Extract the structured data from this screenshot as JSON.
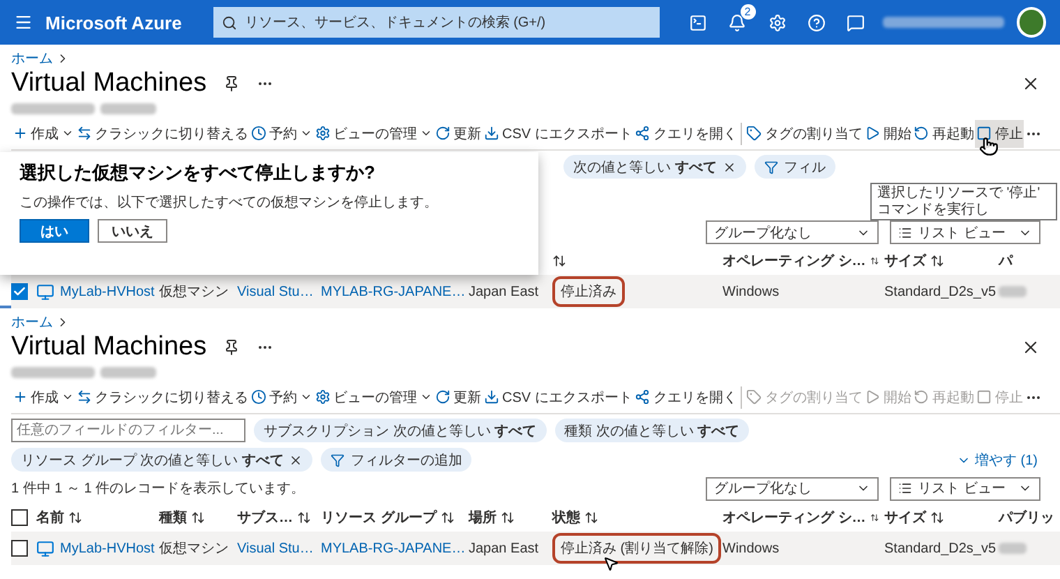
{
  "topbar": {
    "brand": "Microsoft Azure",
    "search_placeholder": "リソース、サービス、ドキュメントの検索 (G+/)",
    "notification_count": "2"
  },
  "panels": [
    {
      "breadcrumb": "ホーム",
      "title": "Virtual Machines",
      "toolbar": [
        {
          "kind": "create",
          "label": "作成",
          "caret": true,
          "disabled": false,
          "hovered": false
        },
        {
          "kind": "switch",
          "label": "クラシックに切り替える",
          "caret": false,
          "disabled": false,
          "hovered": false
        },
        {
          "kind": "schedule",
          "label": "予約",
          "caret": true,
          "disabled": false,
          "hovered": false
        },
        {
          "kind": "view",
          "label": "ビューの管理",
          "caret": true,
          "disabled": false,
          "hovered": false
        },
        {
          "kind": "refresh",
          "label": "更新",
          "caret": false,
          "disabled": false,
          "hovered": false
        },
        {
          "kind": "export",
          "label": "CSV にエクスポート",
          "caret": false,
          "disabled": false,
          "hovered": false
        },
        {
          "kind": "query",
          "label": "クエリを開く",
          "caret": false,
          "disabled": false,
          "hovered": false
        },
        {
          "kind": "divider"
        },
        {
          "kind": "tag",
          "label": "タグの割り当て",
          "caret": false,
          "disabled": false,
          "hovered": false
        },
        {
          "kind": "start",
          "label": "開始",
          "caret": false,
          "disabled": false,
          "hovered": false
        },
        {
          "kind": "restart",
          "label": "再起動",
          "caret": false,
          "disabled": false,
          "hovered": false
        },
        {
          "kind": "stop",
          "label": "停止",
          "caret": false,
          "disabled": false,
          "hovered": true
        },
        {
          "kind": "more",
          "disabled": false,
          "hovered": false
        }
      ],
      "dialog": {
        "title": "選択した仮想マシンをすべて停止しますか?",
        "text": "この操作では、以下で選択したすべての仮想マシンを停止します。",
        "buttons": [
          {
            "label": "はい",
            "primary": true
          },
          {
            "label": "いいえ",
            "primary": false
          }
        ]
      },
      "filters": [
        {
          "kind": "filter",
          "text": "次の値と等しい **すべて**",
          "removable": true
        },
        {
          "kind": "add",
          "text": "フィル"
        }
      ],
      "tooltip": "選択したリソースで '停止' コマンドを実行し",
      "group_by": "グループ化なし",
      "view": "リスト ビュー",
      "columns": [
        {
          "kind": "status",
          "sort": true
        },
        {
          "kind": "os",
          "label": "オペレーティング シ…",
          "sort": true
        },
        {
          "kind": "size",
          "label": "サイズ",
          "sort": true
        },
        {
          "kind": "public",
          "label": "パ"
        }
      ],
      "rows": [
        {
          "selected": true,
          "name": "MyLab-HVHost",
          "type": "仮想マシン",
          "subscription": "Visual Stu…",
          "resource_group": "MYLAB-RG-JAPANE…",
          "location": "Japan East",
          "status": "停止済み",
          "status_highlighted": true,
          "status_cursor": false,
          "os": "Windows",
          "size": "Standard_D2s_v5"
        }
      ]
    },
    {
      "breadcrumb": "ホーム",
      "title": "Virtual Machines",
      "toolbar": [
        {
          "kind": "create",
          "label": "作成",
          "caret": true,
          "disabled": false,
          "hovered": false
        },
        {
          "kind": "switch",
          "label": "クラシックに切り替える",
          "caret": false,
          "disabled": false,
          "hovered": false
        },
        {
          "kind": "schedule",
          "label": "予約",
          "caret": true,
          "disabled": false,
          "hovered": false
        },
        {
          "kind": "view",
          "label": "ビューの管理",
          "caret": true,
          "disabled": false,
          "hovered": false
        },
        {
          "kind": "refresh",
          "label": "更新",
          "caret": false,
          "disabled": false,
          "hovered": false
        },
        {
          "kind": "export",
          "label": "CSV にエクスポート",
          "caret": false,
          "disabled": false,
          "hovered": false
        },
        {
          "kind": "query",
          "label": "クエリを開く",
          "caret": false,
          "disabled": false,
          "hovered": false
        },
        {
          "kind": "divider"
        },
        {
          "kind": "tag",
          "label": "タグの割り当て",
          "caret": false,
          "disabled": true,
          "hovered": false
        },
        {
          "kind": "start",
          "label": "開始",
          "caret": false,
          "disabled": true,
          "hovered": false
        },
        {
          "kind": "restart",
          "label": "再起動",
          "caret": false,
          "disabled": true,
          "hovered": false
        },
        {
          "kind": "stop",
          "label": "停止",
          "caret": false,
          "disabled": true,
          "hovered": false
        },
        {
          "kind": "more",
          "disabled": false,
          "hovered": false
        }
      ],
      "filter_placeholder": "任意のフィールドのフィルター...",
      "filters": [
        {
          "kind": "filter",
          "text": "サブスクリプション 次の値と等しい **すべて**",
          "removable": false
        },
        {
          "kind": "filter",
          "text": "種類 次の値と等しい **すべて**",
          "removable": false
        },
        {
          "kind": "filter",
          "text": "リソース グループ 次の値と等しい **すべて**",
          "removable": true
        },
        {
          "kind": "add",
          "text": "フィルターの追加"
        }
      ],
      "more_filters": "増やす (1)",
      "record_count": "1 件中 1 ～ 1 件のレコードを表示しています。",
      "group_by": "グループ化なし",
      "view": "リスト ビュー",
      "columns": [
        {
          "kind": "select",
          "checked": false
        },
        {
          "kind": "name",
          "label": "名前",
          "sort": true
        },
        {
          "kind": "type",
          "label": "種類",
          "sort": true
        },
        {
          "kind": "subscription",
          "label": "サブス…",
          "sort": true
        },
        {
          "kind": "resource_group",
          "label": "リソース グループ",
          "sort": true
        },
        {
          "kind": "location",
          "label": "場所",
          "sort": true
        },
        {
          "kind": "status",
          "label": "状態",
          "sort": true
        },
        {
          "kind": "os",
          "label": "オペレーティング シ…",
          "sort": true
        },
        {
          "kind": "size",
          "label": "サイズ",
          "sort": true
        },
        {
          "kind": "public",
          "label": "パブリッ"
        }
      ],
      "rows": [
        {
          "selected": false,
          "name": "MyLab-HVHost",
          "type": "仮想マシン",
          "subscription": "Visual Stu…",
          "resource_group": "MYLAB-RG-JAPANE…",
          "location": "Japan East",
          "status": "停止済み (割り当て解除)",
          "status_highlighted": true,
          "status_cursor": true,
          "os": "Windows",
          "size": "Standard_D2s_v5"
        }
      ]
    }
  ]
}
